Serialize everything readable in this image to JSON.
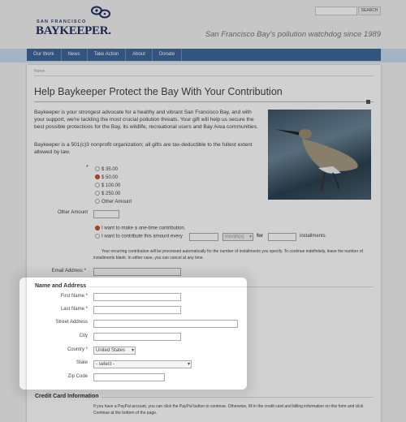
{
  "header": {
    "search_button": "SEARCH",
    "logo_top": "SAN FRANCISCO",
    "logo_main": "BAYKEEPER.",
    "tagline": "San Francisco Bay's pollution watchdog since 1989"
  },
  "nav": [
    "Our Work",
    "News",
    "Take Action",
    "About",
    "Donate"
  ],
  "breadcrumb": "Home",
  "title": "Help Baykeeper Protect the Bay With Your Contribution",
  "intro": "Baykeeper is your strongest advocate for a healthy and vibrant San Francisco Bay, and with your support, we're tackling the most crucial pollution threats. Your gift will help us secure the best possible protections for the Bay, its wildlife, recreational users and Bay Area communities.",
  "nonprofit": "Baykeeper is a 501(c)3 nonprofit organization; all gifts are tax-deductible to the fullest extent allowed by law.",
  "amounts": [
    "$ 35.00",
    "$ 50.00",
    "$ 100.00",
    "$ 250.00",
    "Other Amount"
  ],
  "selected_amount": "$ 50.00",
  "other_amount_label": "Other Amount",
  "one_time": "I want to make a one-time contribution.",
  "recurring": "I want to contribute this amount every",
  "frequency": "month(s)",
  "for": "for",
  "installments": "installments",
  "recurring_note": "Your recurring contribution will be processed automatically for the number of installments you specify. To continue indefinitely, leave the number of installments blank. In either case, you can cancel at any time.",
  "email_label": "Email Address",
  "name_section": "Name and Address",
  "fields": {
    "first": "First Name",
    "last": "Last Name",
    "street": "Street Address",
    "city": "City",
    "country": "Country",
    "state": "State",
    "zip": "Zip Code"
  },
  "country_value": "United States",
  "state_value": "- select -",
  "cc_section": "Credit Card Information",
  "cc_note": "If you have a PayPal account, you can click the PayPal button to continue. Otherwise, fill in the credit card and billing information on this form and click Continue at the bottom of the page.",
  "required_mark": "*"
}
